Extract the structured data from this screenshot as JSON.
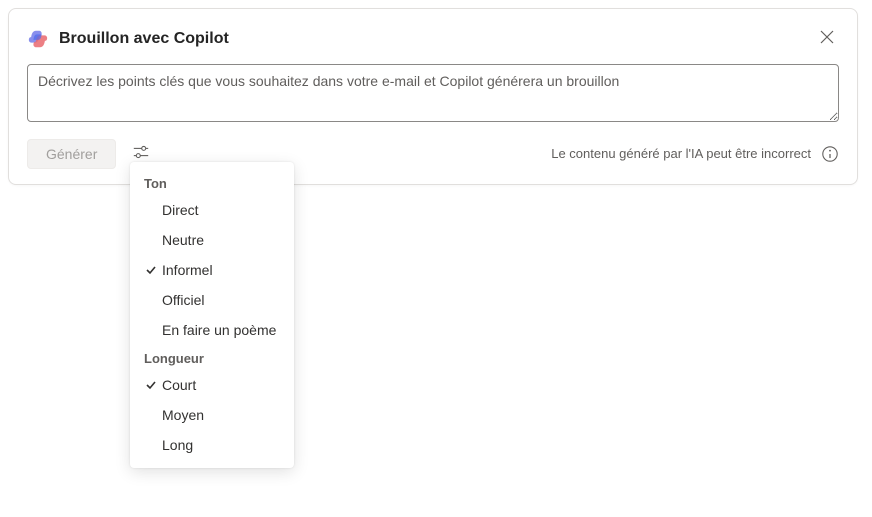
{
  "header": {
    "title": "Brouillon avec Copilot"
  },
  "input": {
    "placeholder": "Décrivez les points clés que vous souhaitez dans votre e-mail et Copilot générera un brouillon",
    "value": ""
  },
  "footer": {
    "generate_label": "Générer",
    "disclaimer": "Le contenu généré par l'IA peut être incorrect"
  },
  "dropdown": {
    "tone_label": "Ton",
    "tone_options": [
      {
        "label": "Direct",
        "selected": false
      },
      {
        "label": "Neutre",
        "selected": false
      },
      {
        "label": "Informel",
        "selected": true
      },
      {
        "label": "Officiel",
        "selected": false
      },
      {
        "label": "En faire un poème",
        "selected": false
      }
    ],
    "length_label": "Longueur",
    "length_options": [
      {
        "label": "Court",
        "selected": true
      },
      {
        "label": "Moyen",
        "selected": false
      },
      {
        "label": "Long",
        "selected": false
      }
    ]
  }
}
